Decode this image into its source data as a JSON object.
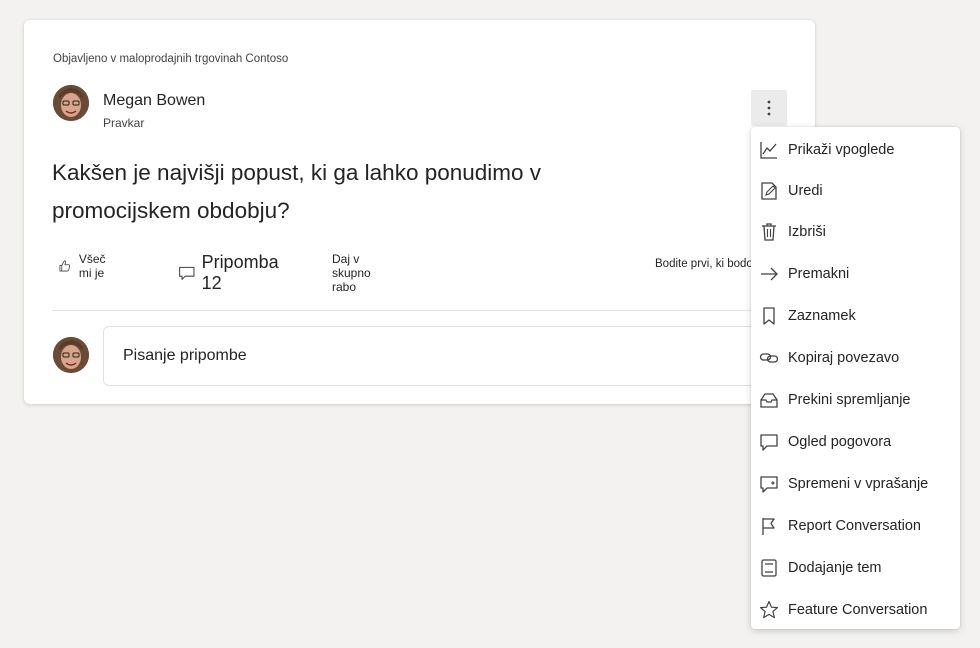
{
  "post": {
    "published_in": "Objavljeno v maloprodajnih trgovinah Contoso",
    "author_name": "Megan Bowen",
    "author_time": "Pravkar",
    "question": "Kakšen je najvišji popust, ki ga lahko ponudimo v promocijskem obdobju?",
    "like_label": "Všeč mi je",
    "comment_label": "Pripomba 12",
    "share_label": "Daj v skupno rabo",
    "be_first_label": "Bodite prvi, ki bodo zboleli"
  },
  "comment_input": {
    "placeholder": "Pisanje pripombe"
  },
  "menu": {
    "items": [
      {
        "label": "Prikaži vpoglede",
        "icon": "chart-icon"
      },
      {
        "label": "Uredi",
        "icon": "edit-icon"
      },
      {
        "label": "Izbriši",
        "icon": "trash-icon"
      },
      {
        "label": "Premakni",
        "icon": "arrow-right-icon"
      },
      {
        "label": "Zaznamek",
        "icon": "bookmark-icon"
      },
      {
        "label": "Kopiraj povezavo",
        "icon": "link-icon"
      },
      {
        "label": "Prekini spremljanje",
        "icon": "inbox-icon"
      },
      {
        "label": "Ogled pogovora",
        "icon": "chat-icon"
      },
      {
        "label": "Spremeni v vprašanje",
        "icon": "question-switch-icon"
      },
      {
        "label": "Report Conversation",
        "icon": "flag-icon"
      },
      {
        "label": "Dodajanje tem",
        "icon": "notebook-icon"
      },
      {
        "label": "Feature Conversation",
        "icon": "star-icon"
      }
    ]
  },
  "colors": {
    "background": "#f3f2f1",
    "card": "#ffffff",
    "text": "#242424",
    "more_button_bg": "#ebebeb"
  }
}
